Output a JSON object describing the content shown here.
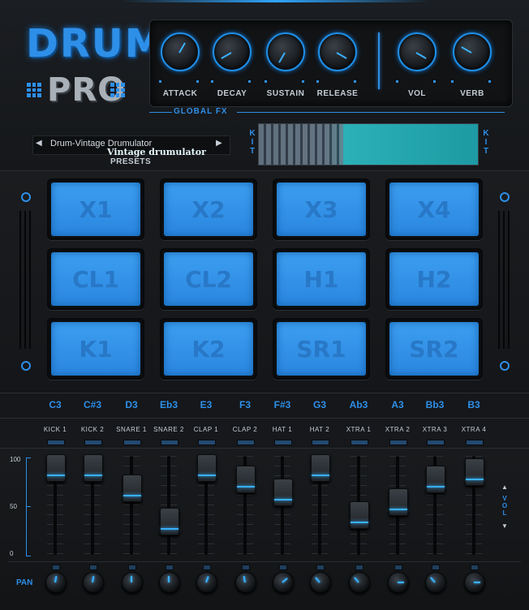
{
  "logo": {
    "line1": "DRUM",
    "line2": "PRO"
  },
  "global_fx": {
    "title": "GLOBAL FX",
    "knobs": [
      {
        "label": "ATTACK",
        "angle": -60
      },
      {
        "label": "DECAY",
        "angle": 150
      },
      {
        "label": "SUSTAIN",
        "angle": 120
      },
      {
        "label": "RELEASE",
        "angle": 30
      },
      {
        "label": "VOL",
        "angle": 30
      },
      {
        "label": "VERB",
        "angle": -150
      }
    ]
  },
  "presets": {
    "label": "PRESETS",
    "value": "Drum-Vintage Drumulator",
    "prev_icon": "triangle-left",
    "next_icon": "triangle-right"
  },
  "kit": {
    "label": "KIT",
    "name": "Vintage drumulator"
  },
  "pads": [
    {
      "label": "X1"
    },
    {
      "label": "X2"
    },
    {
      "label": "X3"
    },
    {
      "label": "X4"
    },
    {
      "label": "CL1"
    },
    {
      "label": "CL2"
    },
    {
      "label": "H1"
    },
    {
      "label": "H2"
    },
    {
      "label": "K1"
    },
    {
      "label": "K2"
    },
    {
      "label": "SR1"
    },
    {
      "label": "SR2"
    }
  ],
  "notes": [
    "C3",
    "C#3",
    "D3",
    "Eb3",
    "E3",
    "F3",
    "F#3",
    "G3",
    "Ab3",
    "A3",
    "Bb3",
    "B3"
  ],
  "mixer": {
    "scale": [
      "100",
      "50",
      "0"
    ],
    "vol_label": "VOL",
    "pan_label": "PAN",
    "channels": [
      {
        "name": "KICK 1",
        "level": 83,
        "pan_angle": -80
      },
      {
        "name": "KICK 2",
        "level": 83,
        "pan_angle": -80
      },
      {
        "name": "SNARE 1",
        "level": 62,
        "pan_angle": -90
      },
      {
        "name": "SNARE 2",
        "level": 29,
        "pan_angle": -90
      },
      {
        "name": "CLAP 1",
        "level": 83,
        "pan_angle": -70
      },
      {
        "name": "CLAP 2",
        "level": 71,
        "pan_angle": -100
      },
      {
        "name": "HAT 1",
        "level": 58,
        "pan_angle": -40
      },
      {
        "name": "HAT 2",
        "level": 83,
        "pan_angle": -130
      },
      {
        "name": "XTRA 1",
        "level": 35,
        "pan_angle": -130
      },
      {
        "name": "XTRA 2",
        "level": 48,
        "pan_angle": 0
      },
      {
        "name": "XTRA 3",
        "level": 71,
        "pan_angle": -130
      },
      {
        "name": "XTRA 4",
        "level": 79,
        "pan_angle": 0
      }
    ]
  },
  "colors": {
    "accent": "#2e8fe8",
    "pad": "#3a9aee",
    "background": "#15171a"
  }
}
